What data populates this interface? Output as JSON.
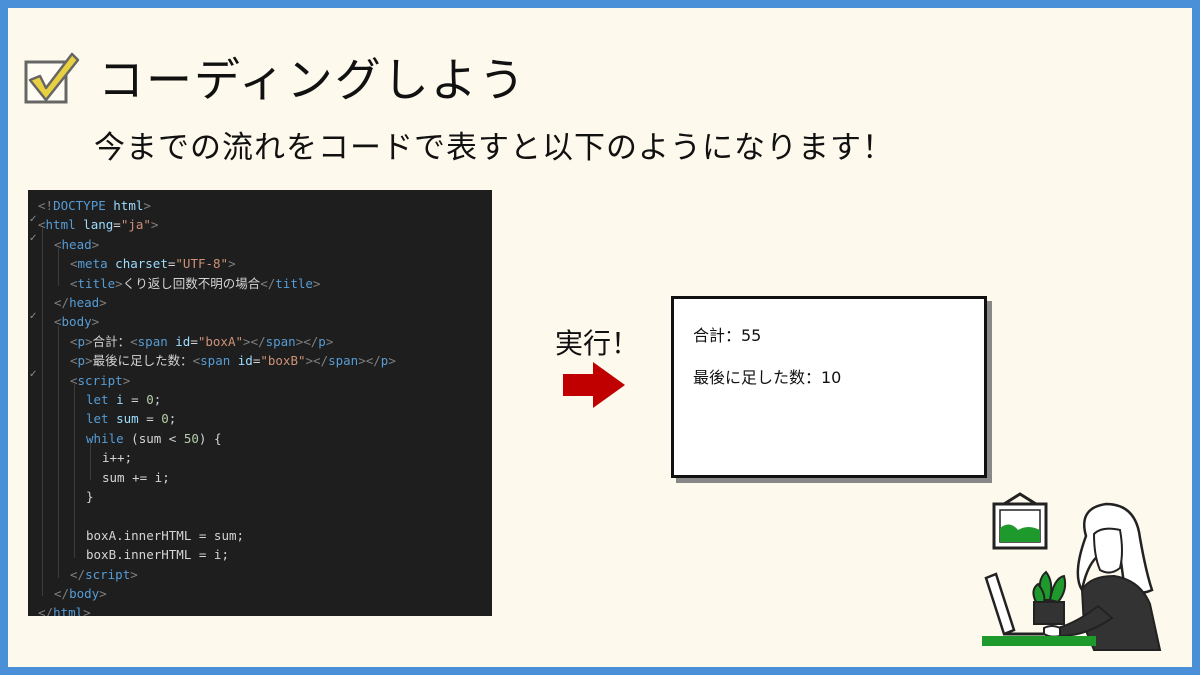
{
  "title": "コーディングしよう",
  "subtitle": "今までの流れをコードで表すと以下のようになります！",
  "code_lines": [
    [
      [
        "t-punc",
        "<!"
      ],
      [
        "t-tag",
        "DOCTYPE"
      ],
      [
        "t-attr",
        " html"
      ],
      [
        "t-punc",
        ">"
      ]
    ],
    [
      [
        "t-punc",
        "<"
      ],
      [
        "t-tag",
        "html"
      ],
      [
        "t-attr",
        " lang"
      ],
      [
        "t-text",
        "="
      ],
      [
        "t-str",
        "\"ja\""
      ],
      [
        "t-punc",
        ">"
      ]
    ],
    [
      [
        "t-punc",
        "<"
      ],
      [
        "t-tag",
        "head"
      ],
      [
        "t-punc",
        ">"
      ]
    ],
    [
      [
        "t-punc",
        "<"
      ],
      [
        "t-tag",
        "meta"
      ],
      [
        "t-attr",
        " charset"
      ],
      [
        "t-text",
        "="
      ],
      [
        "t-str",
        "\"UTF-8\""
      ],
      [
        "t-punc",
        ">"
      ]
    ],
    [
      [
        "t-punc",
        "<"
      ],
      [
        "t-tag",
        "title"
      ],
      [
        "t-punc",
        ">"
      ],
      [
        "t-text",
        "くり返し回数不明の場合"
      ],
      [
        "t-punc",
        "</"
      ],
      [
        "t-tag",
        "title"
      ],
      [
        "t-punc",
        ">"
      ]
    ],
    [
      [
        "t-punc",
        "</"
      ],
      [
        "t-tag",
        "head"
      ],
      [
        "t-punc",
        ">"
      ]
    ],
    [
      [
        "t-punc",
        "<"
      ],
      [
        "t-tag",
        "body"
      ],
      [
        "t-punc",
        ">"
      ]
    ],
    [
      [
        "t-punc",
        "<"
      ],
      [
        "t-tag",
        "p"
      ],
      [
        "t-punc",
        ">"
      ],
      [
        "t-text",
        "合計："
      ],
      [
        "t-punc",
        "<"
      ],
      [
        "t-tag",
        "span"
      ],
      [
        "t-attr",
        " id"
      ],
      [
        "t-text",
        "="
      ],
      [
        "t-str",
        "\"boxA\""
      ],
      [
        "t-punc",
        "></"
      ],
      [
        "t-tag",
        "span"
      ],
      [
        "t-punc",
        "></"
      ],
      [
        "t-tag",
        "p"
      ],
      [
        "t-punc",
        ">"
      ]
    ],
    [
      [
        "t-punc",
        "<"
      ],
      [
        "t-tag",
        "p"
      ],
      [
        "t-punc",
        ">"
      ],
      [
        "t-text",
        "最後に足した数："
      ],
      [
        "t-punc",
        "<"
      ],
      [
        "t-tag",
        "span"
      ],
      [
        "t-attr",
        " id"
      ],
      [
        "t-text",
        "="
      ],
      [
        "t-str",
        "\"boxB\""
      ],
      [
        "t-punc",
        "></"
      ],
      [
        "t-tag",
        "span"
      ],
      [
        "t-punc",
        "></"
      ],
      [
        "t-tag",
        "p"
      ],
      [
        "t-punc",
        ">"
      ]
    ],
    [
      [
        "t-punc",
        "<"
      ],
      [
        "t-tag",
        "script"
      ],
      [
        "t-punc",
        ">"
      ]
    ],
    [
      [
        "t-kw",
        "let"
      ],
      [
        "t-attr",
        " i"
      ],
      [
        "t-text",
        " = "
      ],
      [
        "t-num",
        "0"
      ],
      [
        "t-text",
        ";"
      ]
    ],
    [
      [
        "t-kw",
        "let"
      ],
      [
        "t-attr",
        " sum"
      ],
      [
        "t-text",
        " = "
      ],
      [
        "t-num",
        "0"
      ],
      [
        "t-text",
        ";"
      ]
    ],
    [
      [
        "t-kw",
        "while"
      ],
      [
        "t-text",
        " (sum < "
      ],
      [
        "t-num",
        "50"
      ],
      [
        "t-text",
        ") {"
      ]
    ],
    [
      [
        "t-text",
        "i++;"
      ]
    ],
    [
      [
        "t-text",
        "sum += i;"
      ]
    ],
    [
      [
        "t-text",
        "}"
      ]
    ],
    [
      [
        "t-text",
        ""
      ]
    ],
    [
      [
        "t-text",
        "boxA.innerHTML = sum;"
      ]
    ],
    [
      [
        "t-text",
        "boxB.innerHTML = i;"
      ]
    ],
    [
      [
        "t-punc",
        "</"
      ],
      [
        "t-tag",
        "script"
      ],
      [
        "t-punc",
        ">"
      ]
    ],
    [
      [
        "t-punc",
        "</"
      ],
      [
        "t-tag",
        "body"
      ],
      [
        "t-punc",
        ">"
      ]
    ],
    [
      [
        "t-punc",
        "</"
      ],
      [
        "t-tag",
        "html"
      ],
      [
        "t-punc",
        ">"
      ]
    ]
  ],
  "run_label": "実行！",
  "result": {
    "line1": "合計：55",
    "line2": "最後に足した数：10"
  },
  "icons": [
    "check-icon",
    "right-arrow-icon",
    "person-at-laptop-illustration"
  ],
  "colors": {
    "frame": "#4a90d9",
    "background": "#fdf9ec",
    "code_bg": "#1e1e1e",
    "arrow": "#c00000",
    "check": "#e8d040",
    "plant": "#1e9a2c"
  }
}
